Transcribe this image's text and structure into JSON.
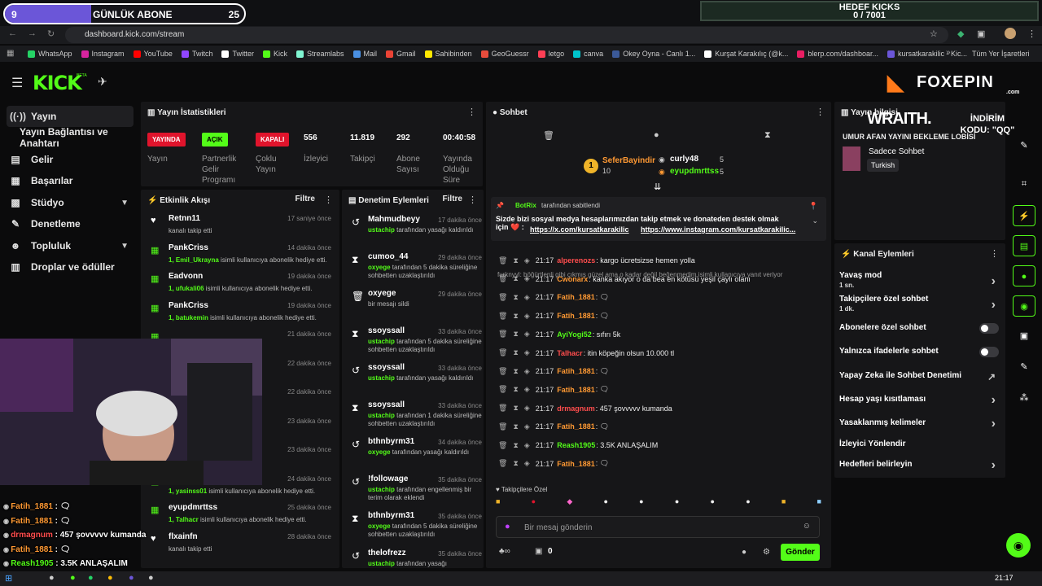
{
  "overlay": {
    "goal_current": "9",
    "goal_label": "GÜNLÜK ABONE",
    "goal_target": "25",
    "goal_progress": 0.36,
    "kick_goal_title": "HEDEF KICKS",
    "kick_goal_value": "0 / 7001"
  },
  "browser": {
    "url": "dashboard.kick.com/stream",
    "bookmarks": [
      {
        "label": "WhatsApp",
        "color": "#25d366"
      },
      {
        "label": "Instagram",
        "color": "#d6249f"
      },
      {
        "label": "YouTube",
        "color": "#ff0000"
      },
      {
        "label": "Twitch",
        "color": "#9146ff"
      },
      {
        "label": "Twitter",
        "color": "#ffffff"
      },
      {
        "label": "Kick",
        "color": "#53fc18"
      },
      {
        "label": "Streamlabs",
        "color": "#80f5d2"
      },
      {
        "label": "Mail",
        "color": "#4a90e2"
      },
      {
        "label": "Gmail",
        "color": "#ea4335"
      },
      {
        "label": "Sahibinden",
        "color": "#ffe800"
      },
      {
        "label": "GeoGuessr",
        "color": "#e74c3c"
      },
      {
        "label": "letgo",
        "color": "#ff3f55"
      },
      {
        "label": "canva",
        "color": "#00c4cc"
      },
      {
        "label": "Okey Oyna - Canlı 1...",
        "color": "#3b5998"
      },
      {
        "label": "Kurşat Karakılıç (@k...",
        "color": "#ffffff"
      },
      {
        "label": "blerp.com/dashboar...",
        "color": "#e91e63"
      },
      {
        "label": "kursatkarakilic - Kic...",
        "color": "#6b56d8"
      }
    ],
    "other_bookmarks": "Tüm Yer İşaretleri"
  },
  "brand": {
    "logo": "KICK",
    "beta": "BETA",
    "sponsor": "FOXEPIN",
    "sponsor_sub": ".com"
  },
  "sidebar": {
    "items": [
      {
        "label": "Yayın",
        "icon": "broadcast-icon"
      },
      {
        "label": "Yayın Bağlantısı ve Anahtarı",
        "icon": ""
      },
      {
        "label": "Gelir",
        "icon": "wallet-icon"
      },
      {
        "label": "Başarılar",
        "icon": "trophy-icon"
      },
      {
        "label": "Stüdyo",
        "icon": "studio-icon"
      },
      {
        "label": "Denetleme",
        "icon": "wrench-icon"
      },
      {
        "label": "Topluluk",
        "icon": "people-icon"
      },
      {
        "label": "Droplar ve ödüller",
        "icon": "gift-icon"
      }
    ]
  },
  "stats": {
    "title": "Yayın İstatistikleri",
    "items": [
      {
        "badge": "YAYINDA",
        "label": "Yayın"
      },
      {
        "badge": "AÇIK",
        "label": "Partnerlik Gelir Programı"
      },
      {
        "badge": "KAPALI",
        "label": "Çoklu Yayın"
      },
      {
        "value": "556",
        "label": "İzleyici"
      },
      {
        "value": "11.819",
        "label": "Takipçi"
      },
      {
        "value": "292",
        "label": "Abone Sayısı"
      },
      {
        "value": "00:40:58",
        "label": "Yayında Olduğu Süre"
      }
    ]
  },
  "activity": {
    "title": "Etkinlik Akışı",
    "filter": "Filtre",
    "items": [
      {
        "name": "Retnn11",
        "time": "17 saniye önce",
        "desc": "kanalı takip etti",
        "hl": ""
      },
      {
        "name": "PankCriss",
        "time": "14 dakika önce",
        "hl": "1, Emil_Ukrayna",
        "desc": " isimli kullanıcıya abonelik hediye etti."
      },
      {
        "name": "Eadvonn",
        "time": "19 dakika önce",
        "hl": "1, ufukali06",
        "desc": " isimli kullanıcıya abonelik hediye etti."
      },
      {
        "name": "PankCriss",
        "time": "19 dakika önce",
        "hl": "1, batukemin",
        "desc": " isimli kullanıcıya abonelik hediye etti."
      },
      {
        "name": "",
        "time": "21 dakika önce",
        "hl": "",
        "desc": ""
      },
      {
        "name": "",
        "time": "22 dakika önce",
        "hl": "",
        "desc": ""
      },
      {
        "name": "",
        "time": "22 dakika önce",
        "hl": "",
        "desc": ""
      },
      {
        "name": "",
        "time": "23 dakika önce",
        "hl": "",
        "desc": ""
      },
      {
        "name": "",
        "time": "23 dakika önce",
        "hl": "",
        "desc": ""
      },
      {
        "name": "Eadvonn",
        "time": "24 dakika önce",
        "hl": "1, yasinss01",
        "desc": " isimli kullanıcıya abonelik hediye etti."
      },
      {
        "name": "eyupdmrttss",
        "time": "25 dakika önce",
        "hl": "1, Talhacr",
        "desc": " isimli kullanıcıya abonelik hediye etti."
      },
      {
        "name": "flxainfn",
        "time": "28 dakika önce",
        "desc": "kanalı takip etti",
        "hl": ""
      }
    ]
  },
  "moderation": {
    "title": "Denetim Eylemleri",
    "filter": "Filtre",
    "items": [
      {
        "icon": "undo-icon",
        "name": "Mahmudbeyy",
        "time": "17 dakika önce",
        "hl": "ustachip",
        "desc": " tarafından yasağı kaldırıldı"
      },
      {
        "icon": "hourglass-icon",
        "name": "cumoo_44",
        "time": "29 dakika önce",
        "hl": "oxyege",
        "desc": " tarafından 5 dakika süreliğine sohbetten uzaklaştırıldı"
      },
      {
        "icon": "trash-icon",
        "name": "oxyege",
        "time": "29 dakika önce",
        "hl": "",
        "desc": "bir mesajı sildi"
      },
      {
        "icon": "hourglass-icon",
        "name": "ssoyssall",
        "time": "33 dakika önce",
        "hl": "ustachip",
        "desc": " tarafından 5 dakika süreliğine sohbetten uzaklaştırıldı"
      },
      {
        "icon": "undo-icon",
        "name": "ssoyssall",
        "time": "33 dakika önce",
        "hl": "ustachip",
        "desc": " tarafından yasağı kaldırıldı"
      },
      {
        "icon": "hourglass-icon",
        "name": "ssoyssall",
        "time": "33 dakika önce",
        "hl": "ustachip",
        "desc": " tarafından 1 dakika süreliğine sohbetten uzaklaştırıldı"
      },
      {
        "icon": "undo-icon",
        "name": "bthnbyrm31",
        "time": "34 dakika önce",
        "hl": "oxyege",
        "desc": " tarafından yasağı kaldırıldı"
      },
      {
        "icon": "undo-icon",
        "name": "!followage",
        "time": "35 dakika önce",
        "hl": "ustachip",
        "desc": " tarafından engellenmiş bir terim olarak eklendi"
      },
      {
        "icon": "hourglass-icon",
        "name": "bthnbyrm31",
        "time": "35 dakika önce",
        "hl": "oxyege",
        "desc": " tarafından 5 dakika süreliğine sohbetten uzaklaştırıldı"
      },
      {
        "icon": "undo-icon",
        "name": "thelofrezz",
        "time": "35 dakika önce",
        "hl": "ustachip",
        "desc": " tarafından yasağı"
      }
    ]
  },
  "chat": {
    "title": "Sohbet",
    "leader": {
      "rank": "1",
      "name": "SeferBayindir",
      "count": "10"
    },
    "top2": {
      "name": "curly48",
      "count": "5"
    },
    "top3": {
      "name": "eyupdmrttss",
      "count": "5"
    },
    "pinned_by": "BotRix",
    "pinned_suffix": " tarafından sabitlendi",
    "pinned_text": "Sizde bizi sosyal medya hesaplarımızdan takip etmek ve donateden destek olmak için ❤️ :",
    "pinned_link1": "https://x.com/kursatkarakilic",
    "pinned_link2": "https://www.instagram.com/kursatkarakilic...",
    "reply_note": "furknyyl: böğürtlenli gibi çıkmış güzel ama o kadar değil beğenmedim isimli kullanıcıya yanıt veriyor",
    "messages": [
      {
        "time": "21:17",
        "user": "alperenozs",
        "color": "#ff4d4d",
        "text": ": kargo ücretsizse hemen yolla"
      },
      {
        "time": "21:17",
        "user": "Cwonarx",
        "color": "#ff9933",
        "text": ": kanka akıyor o da bea en kötüsü yeşil çaylı olanı"
      },
      {
        "time": "21:17",
        "user": "Fatih_1881",
        "color": "#ff9933",
        "text": ": 🗨"
      },
      {
        "time": "21:17",
        "user": "Fatih_1881",
        "color": "#ff9933",
        "text": ": 🗨"
      },
      {
        "time": "21:17",
        "user": "AyiYogi52",
        "color": "#53fc18",
        "text": ": sıfırı 5k"
      },
      {
        "time": "21:17",
        "user": "Talhacr",
        "color": "#ff4d4d",
        "text": ": itin köpeğin olsun 10.000 tl"
      },
      {
        "time": "21:17",
        "user": "Fatih_1881",
        "color": "#ff9933",
        "text": ": 🗨"
      },
      {
        "time": "21:17",
        "user": "Fatih_1881",
        "color": "#ff9933",
        "text": ": 🗨"
      },
      {
        "time": "21:17",
        "user": "drmagnum",
        "color": "#ff4d4d",
        "text": ": 457 şovvvvv kumanda"
      },
      {
        "time": "21:17",
        "user": "Fatih_1881",
        "color": "#ff9933",
        "text": ": 🗨"
      },
      {
        "time": "21:17",
        "user": "Reash1905",
        "color": "#53fc18",
        "text": ": 3.5K ANLAŞALIM"
      },
      {
        "time": "21:17",
        "user": "Fatih_1881",
        "color": "#ff9933",
        "text": ": 🗨"
      }
    ],
    "followers_only": "Takipçilere Özel",
    "input_placeholder": "Bir mesaj gönderin",
    "count": "0",
    "send": "Gönder"
  },
  "stream_info": {
    "title": "Yayın bilgisi",
    "wraith": "WRAITH.",
    "promo": "İNDİRİM KODU: \"QQ\"",
    "lobby": "UMUR AFAN YAYINI BEKLEME LOBİSİ",
    "category": "Sadece Sohbet",
    "tag": "Turkish"
  },
  "channel_actions": {
    "title": "Kanal Eylemleri",
    "items": [
      {
        "label": "Yavaş mod",
        "sub": "1 sn.",
        "type": "chevron"
      },
      {
        "label": "Takipçilere özel sohbet",
        "sub": "1 dk.",
        "type": "chevron"
      },
      {
        "label": "Abonelere özel sohbet",
        "sub": "",
        "type": "toggle"
      },
      {
        "label": "Yalnızca ifadelerle sohbet",
        "sub": "",
        "type": "toggle"
      },
      {
        "label": "Yapay Zeka ile Sohbet Denetimi",
        "sub": "",
        "type": "external"
      },
      {
        "label": "Hesap yaşı kısıtlaması",
        "sub": "",
        "type": "chevron"
      },
      {
        "label": "Yasaklanmış kelimeler",
        "sub": "",
        "type": "chevron"
      },
      {
        "label": "İzleyici Yönlendir",
        "sub": "",
        "type": "none"
      },
      {
        "label": "Hedefleri belirleyin",
        "sub": "",
        "type": "chevron"
      }
    ]
  },
  "overlay_chat": [
    {
      "user": "Fatih_1881",
      "color": "#ff9933",
      "text": " : 🗨"
    },
    {
      "user": "Fatih_1881",
      "color": "#ff9933",
      "text": " : 🗨"
    },
    {
      "user": "drmagnum",
      "color": "#ff4d4d",
      "text": " : 457 şovvvvv kumanda"
    },
    {
      "user": "Fatih_1881",
      "color": "#ff9933",
      "text": " : 🗨"
    },
    {
      "user": "Reash1905",
      "color": "#53fc18",
      "text": " : 3.5K ANLAŞALIM"
    },
    {
      "user": "Fatih_1881",
      "color": "#ff9933",
      "text": " : 🗨"
    }
  ],
  "taskbar": {
    "clock": "21:17"
  },
  "colors": {
    "accent": "#53fc18",
    "live": "#e0142c",
    "goal": "#6b56d8"
  }
}
